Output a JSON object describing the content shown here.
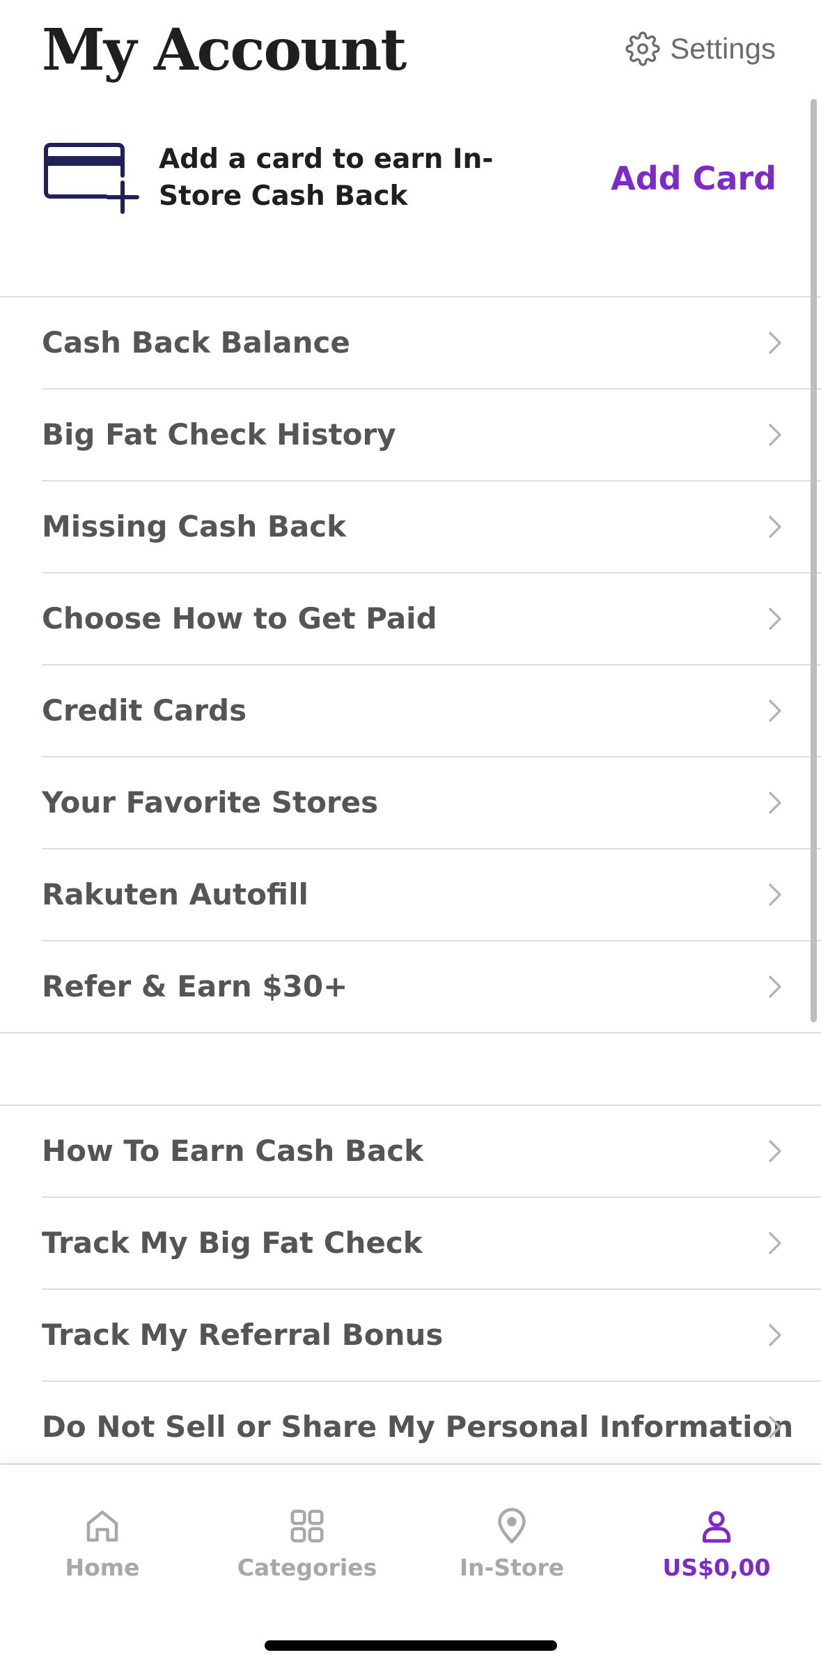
{
  "header": {
    "title": "My Account",
    "settings_label": "Settings",
    "settings_icon": "gear-icon"
  },
  "card_banner": {
    "icon": "credit-card-add-icon",
    "text": "Add a card to earn In-Store Cash Back",
    "button_label": "Add Card"
  },
  "menu_primary": [
    {
      "label": "Cash Back Balance"
    },
    {
      "label": "Big Fat Check History"
    },
    {
      "label": "Missing Cash Back"
    },
    {
      "label": "Choose How to Get Paid"
    },
    {
      "label": "Credit Cards"
    },
    {
      "label": "Your Favorite Stores"
    },
    {
      "label": "Rakuten Autofill"
    },
    {
      "label": "Refer & Earn $30+"
    }
  ],
  "menu_secondary": [
    {
      "label": "How To Earn Cash Back"
    },
    {
      "label": "Track My Big Fat Check"
    },
    {
      "label": "Track My Referral Bonus"
    },
    {
      "label": "Do Not Sell or Share My Personal Information"
    }
  ],
  "tab_bar": {
    "tabs": [
      {
        "label": "Home",
        "icon": "home-icon",
        "active": false
      },
      {
        "label": "Categories",
        "icon": "grid-icon",
        "active": false
      },
      {
        "label": "In-Store",
        "icon": "location-pin-icon",
        "active": false
      },
      {
        "label": "US$0,00",
        "icon": "person-icon",
        "active": true
      }
    ]
  },
  "colors": {
    "accent": "#7e29c9",
    "card_icon": "#22205a",
    "text_primary": "#1f1f1f",
    "text_secondary": "#555555",
    "tab_inactive": "#a8a8a8",
    "divider": "#dddddd"
  }
}
